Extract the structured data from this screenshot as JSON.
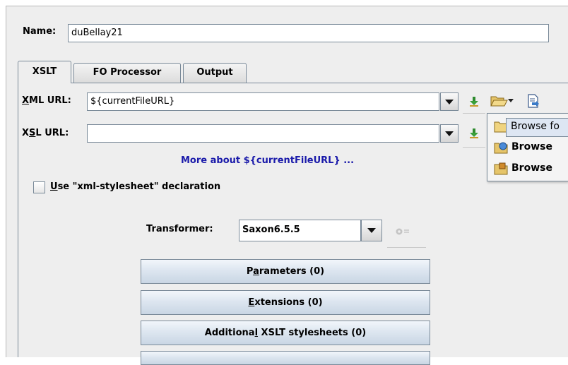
{
  "dialog": {
    "name_label": "Name:",
    "name_value": "duBellay21"
  },
  "tabs": [
    {
      "label": "XSLT",
      "active": true
    },
    {
      "label": "FO Processor",
      "active": false
    },
    {
      "label": "Output",
      "active": false
    }
  ],
  "xslt": {
    "xml_url": {
      "label_pre": "",
      "mnemonic": "X",
      "label_post": "ML URL:",
      "value": "${currentFileURL}"
    },
    "xsl_url": {
      "label_pre": "X",
      "mnemonic": "S",
      "label_post": "L URL:",
      "value": ""
    },
    "more_link": "More about ${currentFileURL} ...",
    "stylesheet_checkbox": {
      "mnemonic": "U",
      "label_post": "se \"xml-stylesheet\" declaration",
      "checked": false
    },
    "transformer": {
      "label": "Transformer:",
      "value": "Saxon6.5.5"
    },
    "buttons": [
      {
        "pre": "P",
        "mnemonic": "a",
        "post": "rameters (0)"
      },
      {
        "pre": "",
        "mnemonic": "E",
        "post": "xtensions (0)"
      },
      {
        "pre": "Additiona",
        "mnemonic": "l",
        "post": " XSLT stylesheets (0)"
      }
    ]
  },
  "browse_menu": {
    "items": [
      "Browse fo",
      "Browse",
      "Browse"
    ]
  },
  "colors": {
    "link": "#1a1aaa",
    "panel_bg": "#eeeeee",
    "border": "#7a8a99"
  },
  "icons": {
    "insert_editor_variables": "green-arrow-down-icon",
    "browse": "folder-open-icon",
    "open_in_editor": "document-arrow-icon",
    "transformer_config": "gear-icon"
  }
}
